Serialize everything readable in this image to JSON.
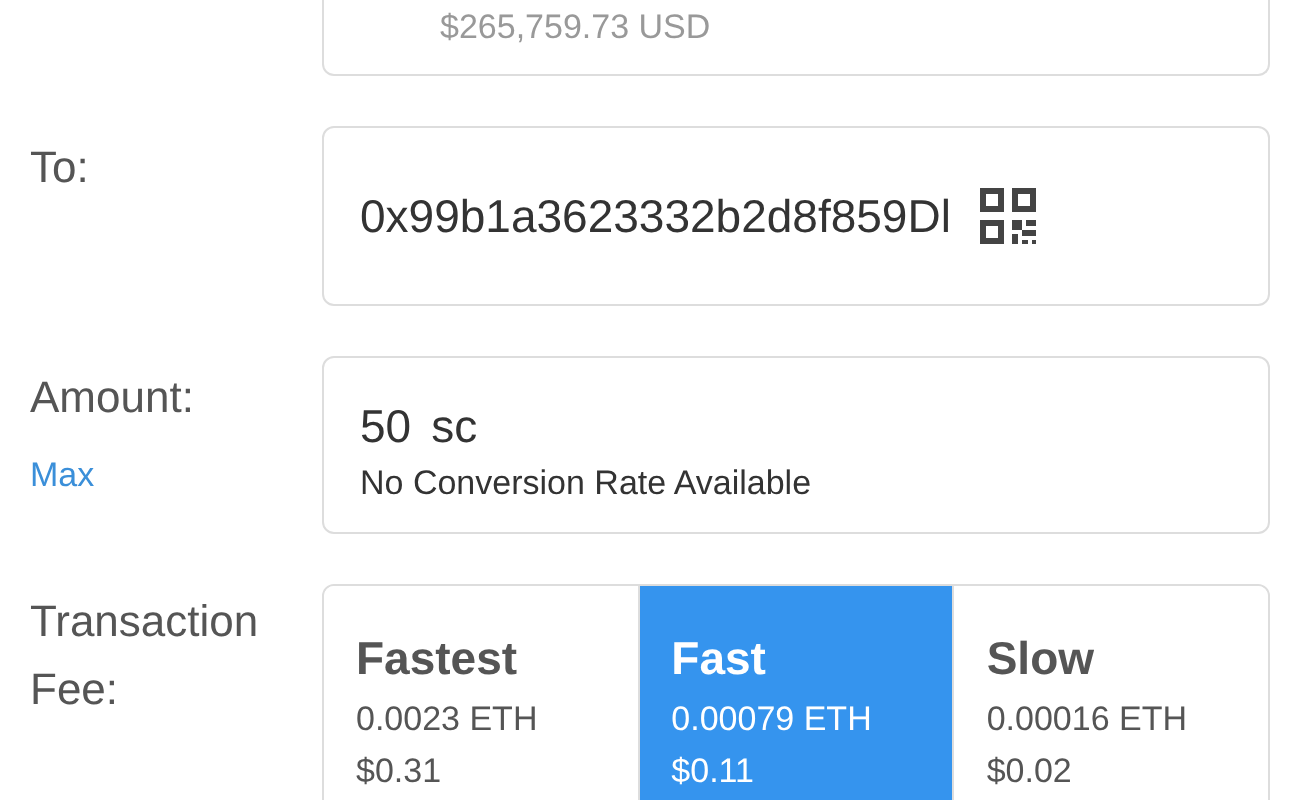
{
  "balance": {
    "usd": "$265,759.73 USD"
  },
  "to": {
    "label": "To:",
    "value": "0x99b1a3623332b2d8f859Dl"
  },
  "amount": {
    "label": "Amount:",
    "max_link": "Max",
    "value": "50",
    "unit": "sc",
    "conversion": "No Conversion Rate Available"
  },
  "fee": {
    "label": "Transaction Fee:",
    "options": [
      {
        "name": "Fastest",
        "eth": "0.0023 ETH",
        "usd": "$0.31",
        "selected": false
      },
      {
        "name": "Fast",
        "eth": "0.00079 ETH",
        "usd": "$0.11",
        "selected": true
      },
      {
        "name": "Slow",
        "eth": "0.00016 ETH",
        "usd": "$0.02",
        "selected": false
      }
    ]
  }
}
